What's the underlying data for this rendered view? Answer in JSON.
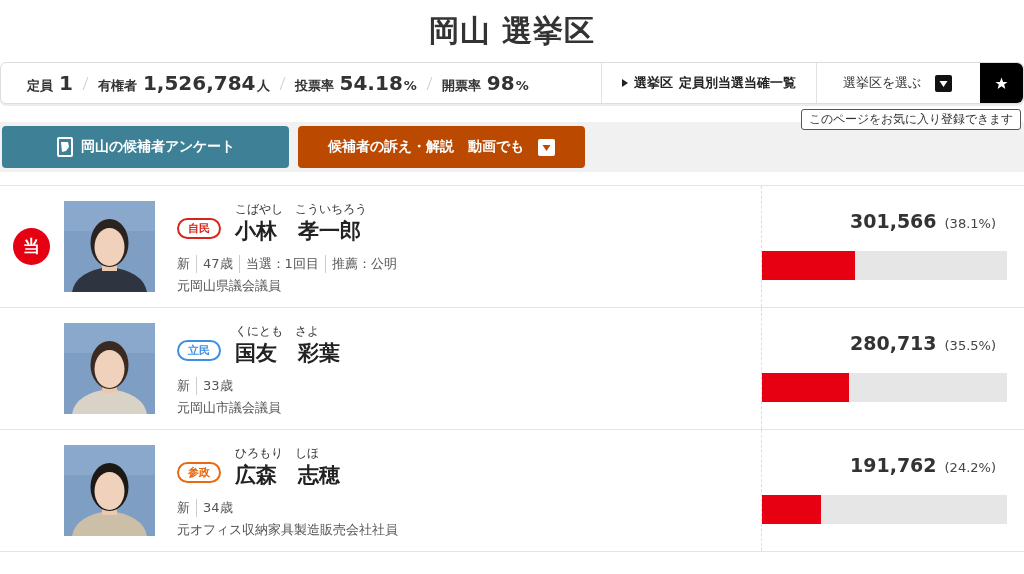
{
  "title": "岡山 選挙区",
  "stats": [
    {
      "label": "定員",
      "value": "1"
    },
    {
      "label": "有権者",
      "value": "1,526,784",
      "unit": "人"
    },
    {
      "label": "投票率",
      "value": "54.18",
      "unit": "%"
    },
    {
      "label": "開票率",
      "value": "98",
      "unit": "%"
    }
  ],
  "nav": {
    "list_link": {
      "prefix": "選挙区",
      "text": "定員別当選当確一覧"
    },
    "district_select": "選挙区を選ぶ",
    "tooltip": "このページをお気に入り登録できます"
  },
  "buttons": [
    {
      "kind": "survey",
      "label": "岡山の候補者アンケート"
    },
    {
      "kind": "video",
      "label": "候補者の訴え・解説　動画でも"
    }
  ],
  "candidates": [
    {
      "elected": true,
      "win_mark": "当",
      "party": "自民",
      "color": "#d6251d",
      "reading": "こばやし　こういちろう",
      "name": "小林　孝一郎",
      "details": [
        "新",
        "47歳",
        "当選：1回目",
        "推薦：公明"
      ],
      "career": "元岡山県議会議員",
      "votes": "301,566",
      "share": "(38.1%)",
      "level": 0.38
    },
    {
      "elected": false,
      "party": "立民",
      "color": "#3d8fe6",
      "reading": "くにとも　さよ",
      "name": "国友　彩葉",
      "details": [
        "新",
        "33歳"
      ],
      "career": "元岡山市議会議員",
      "votes": "280,713",
      "share": "(35.5%)",
      "level": 0.355
    },
    {
      "elected": false,
      "party": "参政",
      "color": "#e8690f",
      "reading": "ひろもり　しほ",
      "name": "広森　志穂",
      "details": [
        "新",
        "34歳"
      ],
      "career": "元オフィス収納家具製造販売会社社員",
      "votes": "191,762",
      "share": "(24.2%)",
      "level": 0.24
    }
  ]
}
